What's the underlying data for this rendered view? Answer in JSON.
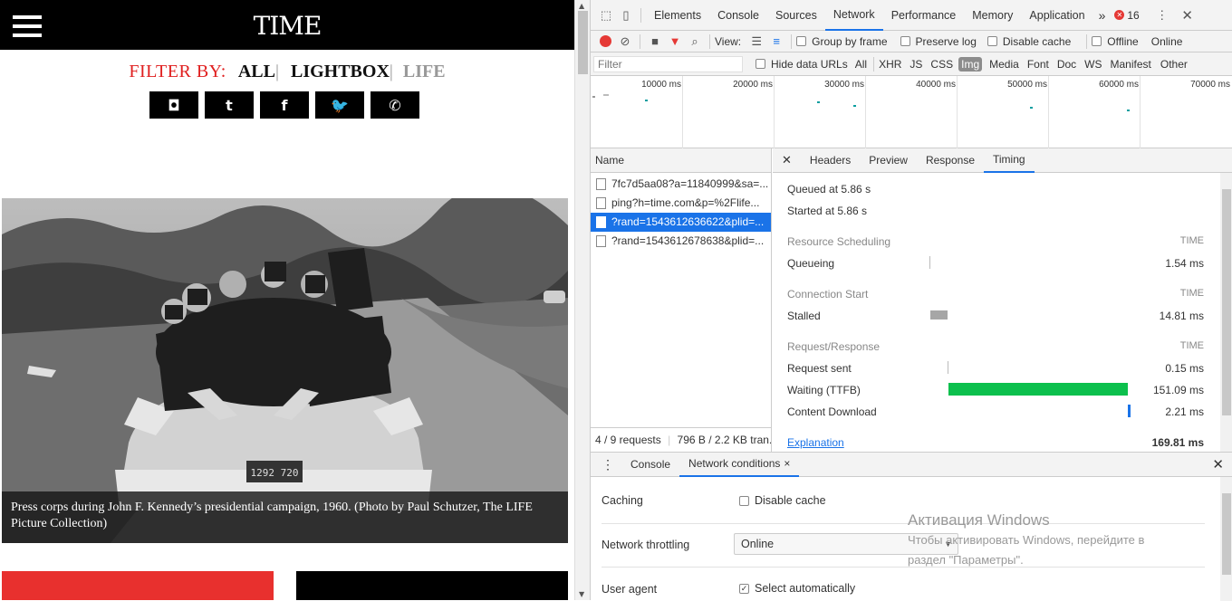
{
  "site": {
    "logo": "TIME",
    "filter_label": "FILTER BY:",
    "filters": [
      "ALL",
      "LIGHTBOX",
      "LIFE"
    ],
    "filter_sep": "|",
    "social": [
      "instagram-icon",
      "tumblr-icon",
      "facebook-icon",
      "twitter-icon",
      "whatsapp-icon"
    ],
    "social_glyphs": [
      "◘",
      "t",
      "f",
      "🐦",
      "✆"
    ],
    "caption": "Press corps during John F. Kennedy’s presidential campaign, 1960. (Photo by Paul Schutzer, The LIFE Picture Collection)",
    "plate": "1292 720",
    "accent_red": "#e8302e"
  },
  "devtools": {
    "tabs": [
      "Elements",
      "Console",
      "Sources",
      "Network",
      "Performance",
      "Memory",
      "Application"
    ],
    "more": "»",
    "error_count": "16",
    "toolbar": {
      "view_label": "View:",
      "group_by_frame": "Group by frame",
      "preserve_log": "Preserve log",
      "disable_cache": "Disable cache",
      "offline": "Offline",
      "online": "Online"
    },
    "filterbar": {
      "filter_placeholder": "Filter",
      "hide_data_urls": "Hide data URLs",
      "types": [
        "All",
        "XHR",
        "JS",
        "CSS",
        "Img",
        "Media",
        "Font",
        "Doc",
        "WS",
        "Manifest",
        "Other"
      ],
      "selected_type": "Img"
    },
    "overview_ticks": [
      "10000 ms",
      "20000 ms",
      "30000 ms",
      "40000 ms",
      "50000 ms",
      "60000 ms",
      "70000 ms"
    ],
    "name_header": "Name",
    "requests": [
      "7fc7d5aa08?a=11840999&sa=...",
      "ping?h=time.com&p=%2Flife...",
      "?rand=1543612636622&plid=...",
      "?rand=1543612678638&plid=..."
    ],
    "selected_request": 2,
    "status": "4 / 9 requests",
    "status_size": "796 B / 2.2 KB tran...",
    "detail_tabs": [
      "Headers",
      "Preview",
      "Response",
      "Timing"
    ],
    "selected_detail_tab": "Timing",
    "timing": {
      "queued": "Queued at 5.86 s",
      "started": "Started at 5.86 s",
      "sections": [
        {
          "title": "Resource Scheduling",
          "time_label": "TIME",
          "rows": [
            {
              "label": "Queueing",
              "value": "1.54 ms"
            }
          ]
        },
        {
          "title": "Connection Start",
          "time_label": "TIME",
          "rows": [
            {
              "label": "Stalled",
              "value": "14.81 ms"
            }
          ]
        },
        {
          "title": "Request/Response",
          "time_label": "TIME",
          "rows": [
            {
              "label": "Request sent",
              "value": "0.15 ms"
            },
            {
              "label": "Waiting (TTFB)",
              "value": "151.09 ms"
            },
            {
              "label": "Content Download",
              "value": "2.21 ms"
            }
          ]
        }
      ],
      "explanation": "Explanation",
      "total": "169.81 ms",
      "ttfb_color": "#0cc04d",
      "download_color": "#1a73e8",
      "stalled_color": "#a6a6a6"
    },
    "drawer": {
      "tabs": [
        "Console",
        "Network conditions"
      ],
      "selected": "Network conditions",
      "close": "×",
      "caching_label": "Caching",
      "disable_cache": "Disable cache",
      "throttling_label": "Network throttling",
      "throttling_value": "Online",
      "user_agent_label": "User agent",
      "select_auto": "Select automatically"
    }
  },
  "watermark": {
    "title": "Активация Windows",
    "line1": "Чтобы активировать Windows, перейдите в",
    "line2": "раздел \"Параметры\"."
  }
}
